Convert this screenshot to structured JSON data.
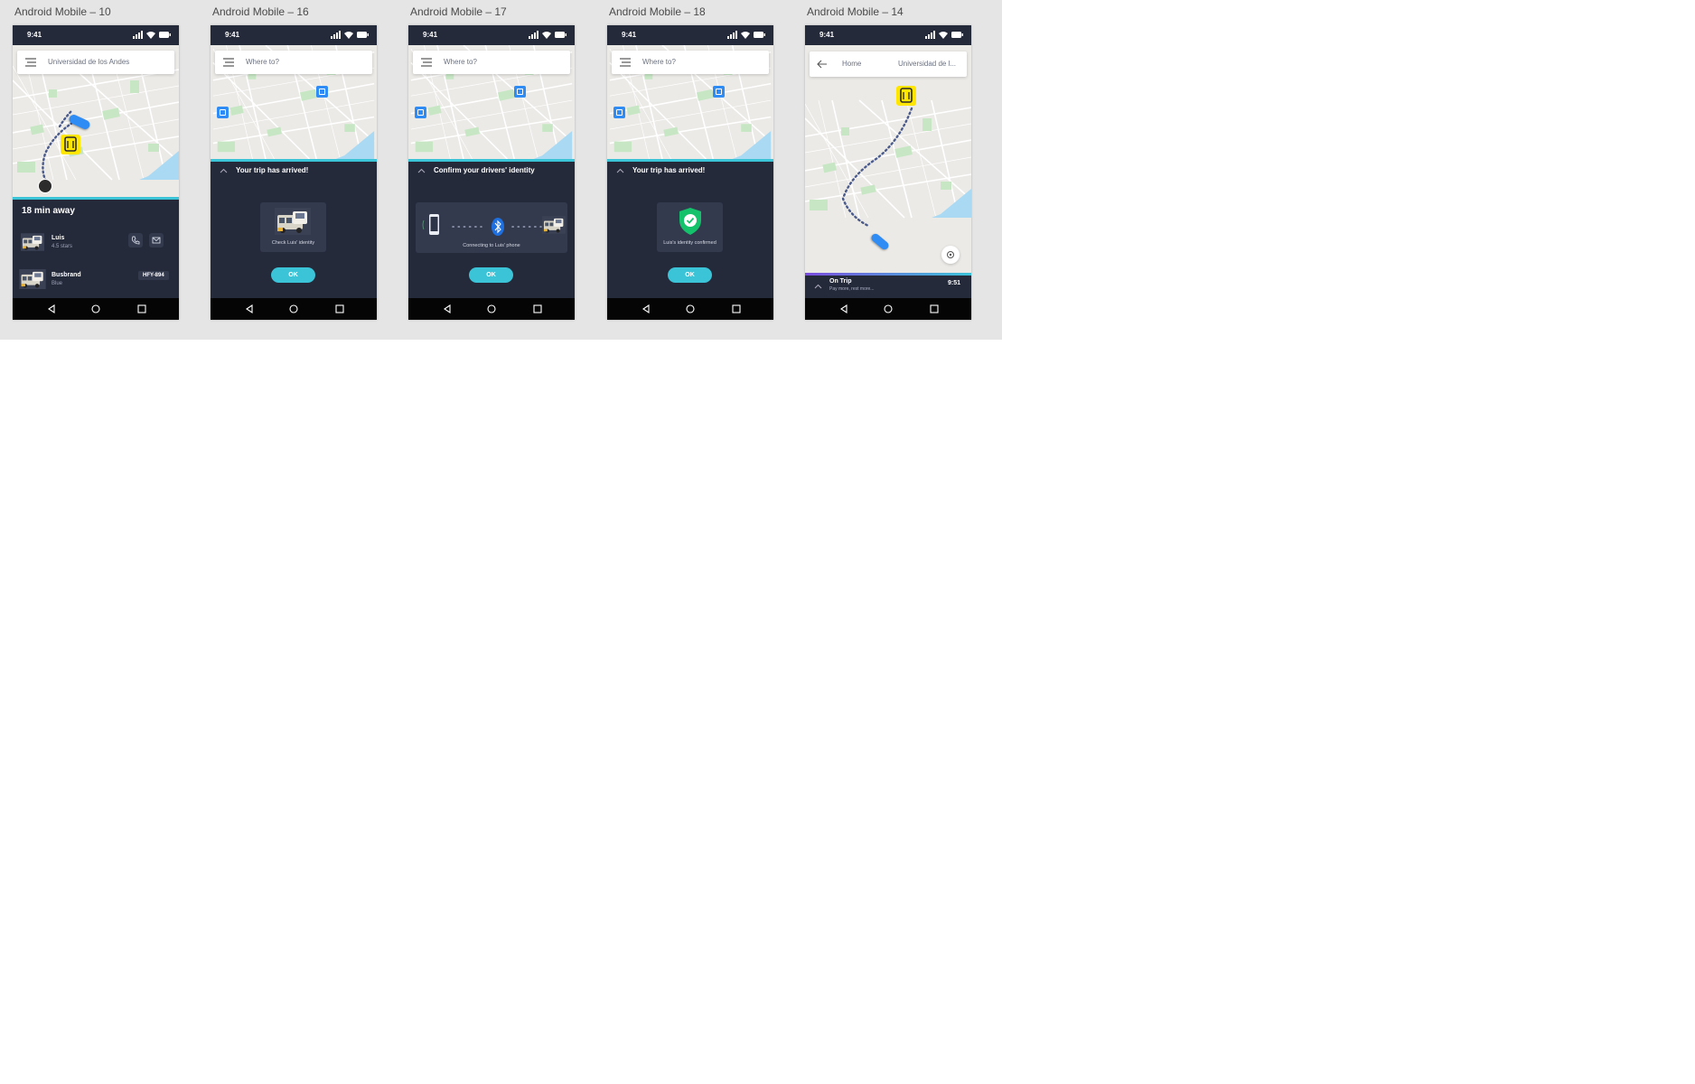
{
  "frames": [
    {
      "label": "Android Mobile – 10"
    },
    {
      "label": "Android Mobile – 16"
    },
    {
      "label": "Android Mobile – 17"
    },
    {
      "label": "Android Mobile – 18"
    },
    {
      "label": "Android Mobile – 14"
    }
  ],
  "status": {
    "time": "9:41"
  },
  "colors": {
    "accent": "#3bc3d8",
    "sheet": "#252a3b",
    "card": "#343a4e",
    "pin": "#2f8cf5",
    "bus_yellow": "#ffe600",
    "success": "#14c26b"
  },
  "screen10": {
    "search_value": "Universidad de los Andes",
    "eta": "18 min away",
    "driver_name": "Luis",
    "driver_rating": "4.5 stars",
    "bus_brand": "Busbrand",
    "bus_color": "Blue",
    "plate": "HFY-894"
  },
  "screen16": {
    "search_placeholder": "Where to?",
    "title": "Your trip has arrived!",
    "caption": "Check Luis' identity",
    "ok": "OK"
  },
  "screen17": {
    "search_placeholder": "Where to?",
    "title": "Confirm your drivers' identity",
    "caption": "Connecting to Luis' phone",
    "ok": "OK"
  },
  "screen18": {
    "search_placeholder": "Where to?",
    "title": "Your trip has arrived!",
    "caption": "Luis's identity confirmed",
    "ok": "OK"
  },
  "screen14": {
    "origin": "Home",
    "destination": "Universidad de l...",
    "trip_status": "On Trip",
    "trip_subtitle": "Pay more, rest more...",
    "arrival_time": "9:51"
  }
}
